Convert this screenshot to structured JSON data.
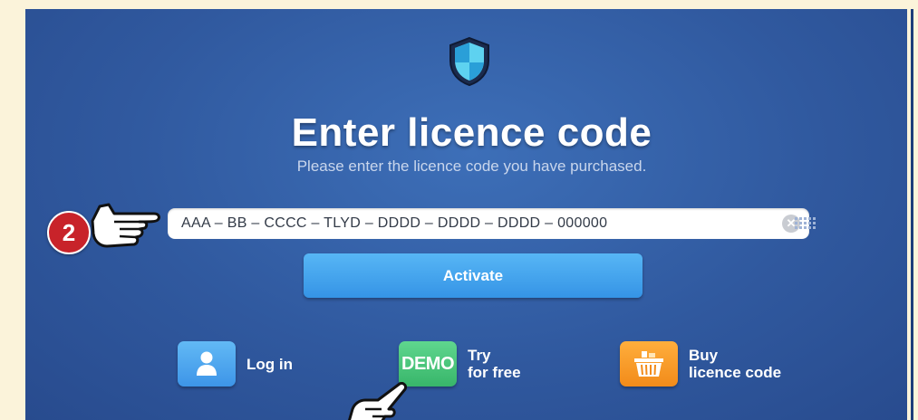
{
  "dialog": {
    "title": "Enter licence code",
    "subtitle": "Please enter the licence code you have purchased."
  },
  "licence_input": {
    "value": "AAA – BB  –  CCCC  –   TLYD  –  DDDD  –  DDDD  –  DDDD   –    000000",
    "clear_icon": "clear-icon",
    "keypad_icon": "keypad-icon"
  },
  "activate_button": {
    "label": "Activate"
  },
  "options": {
    "login": {
      "label": "Log in",
      "icon": "user-icon"
    },
    "demo": {
      "badge": "DEMO",
      "line1": "Try",
      "line2": "for free"
    },
    "buy": {
      "line1": "Buy",
      "line2": "licence code",
      "icon": "basket-icon"
    }
  },
  "annotation": {
    "step_number": "2"
  },
  "colors": {
    "background": "#fbf3da",
    "panel": "#30599f",
    "accent_blue": "#3d95e8",
    "demo_green": "#38b66a",
    "buy_orange": "#f28b1a",
    "badge_red": "#c8232a"
  }
}
